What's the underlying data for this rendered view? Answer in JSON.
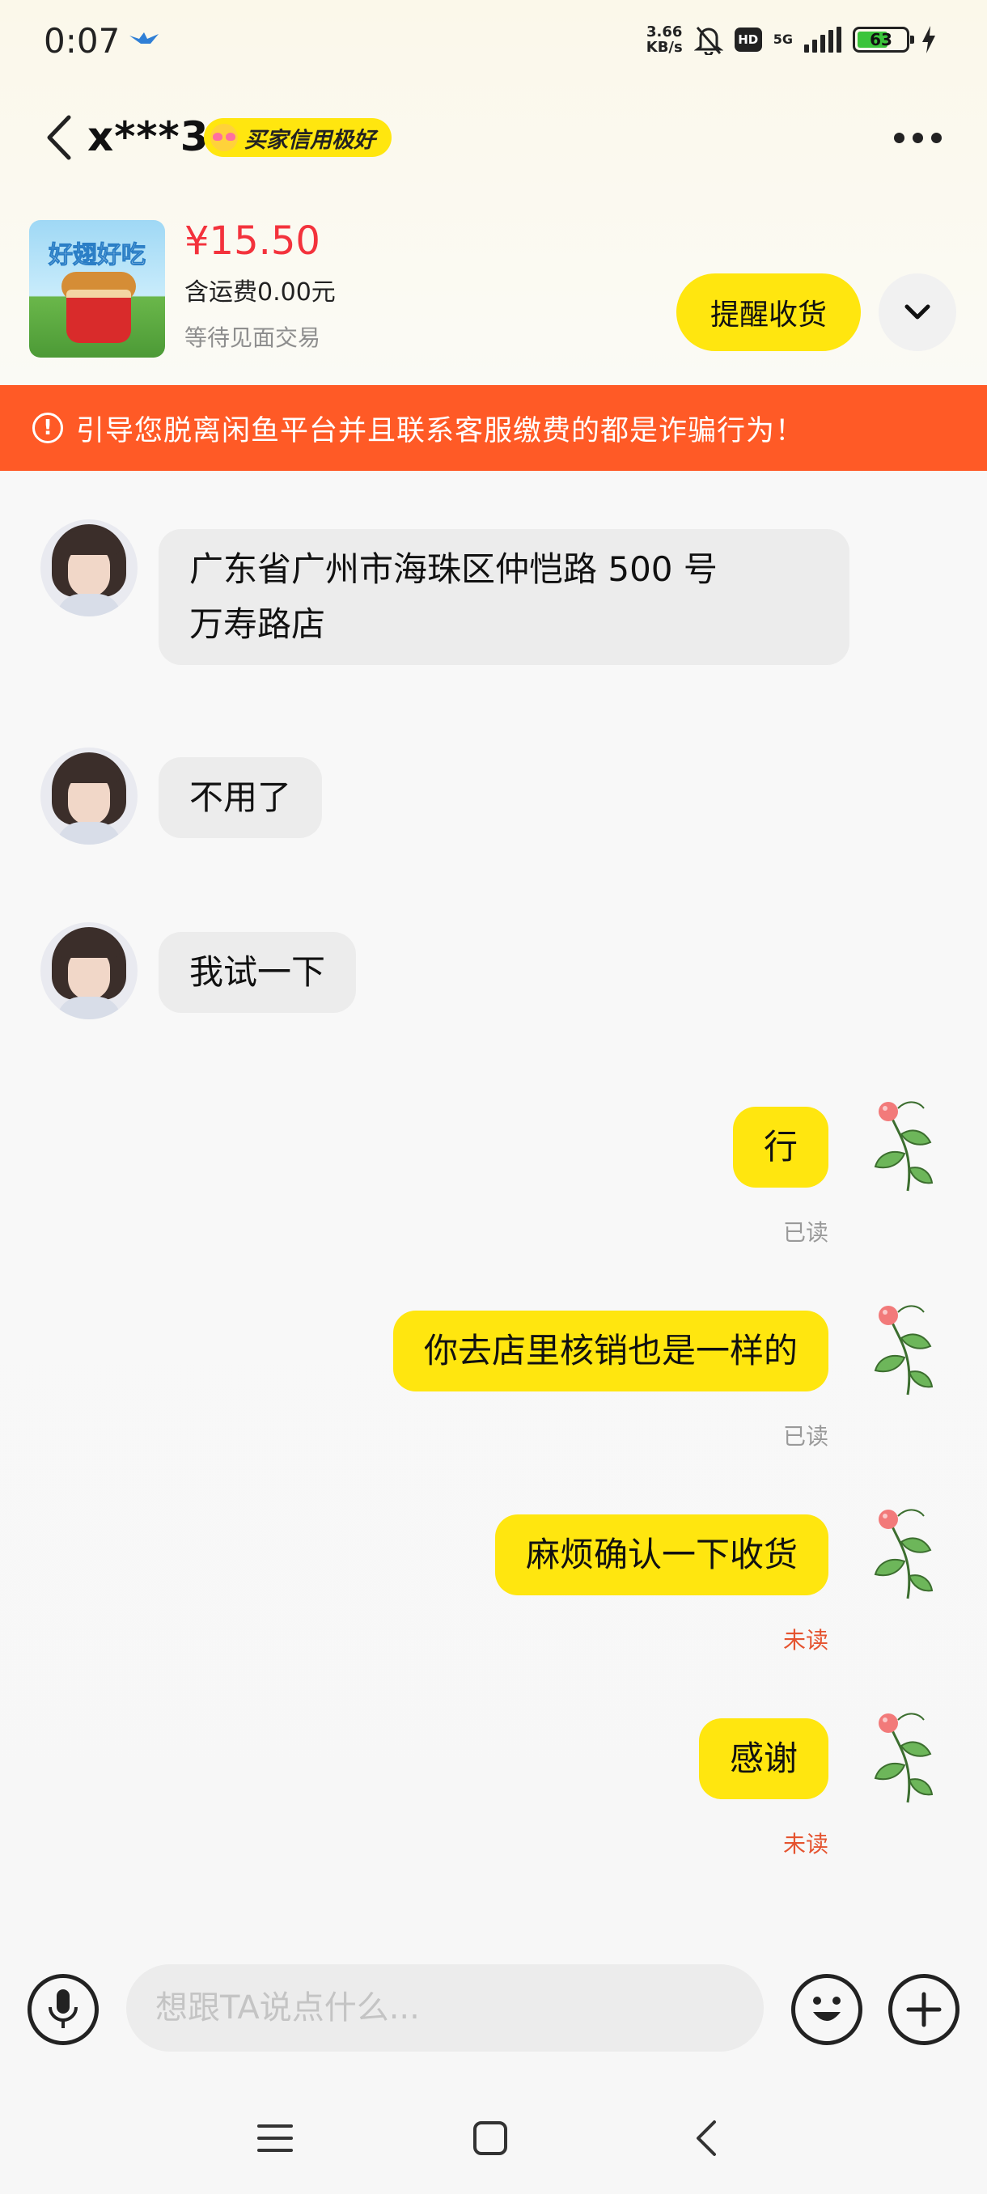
{
  "status_bar": {
    "time": "0:07",
    "net_speed_value": "3.66",
    "net_speed_unit": "KB/s",
    "hd": "HD",
    "network": "5G",
    "battery": "63"
  },
  "header": {
    "username": "x***3",
    "credit_badge": "买家信用极好"
  },
  "product": {
    "thumb_title": "好翅好吃",
    "price": "¥15.50",
    "shipping": "含运费0.00元",
    "status": "等待见面交易",
    "remind_button": "提醒收货"
  },
  "warning": {
    "icon": "!",
    "text": "引导您脱离闲鱼平台并且联系客服缴费的都是诈骗行为！"
  },
  "messages": [
    {
      "from": "other",
      "lines": [
        "广东省广州市海珠区仲恺路 500 号",
        "万寿路店"
      ]
    },
    {
      "from": "other",
      "text": "不用了"
    },
    {
      "from": "other",
      "text": "我试一下"
    },
    {
      "from": "self",
      "text": "行",
      "status": "已读"
    },
    {
      "from": "self",
      "text": "你去店里核销也是一样的",
      "status": "已读"
    },
    {
      "from": "self",
      "text": "麻烦确认一下收货",
      "status": "未读"
    },
    {
      "from": "self",
      "text": "感谢",
      "status": "未读"
    }
  ],
  "input": {
    "placeholder": "想跟TA说点什么..."
  },
  "colors": {
    "accent_yellow": "#ffe60f",
    "warning_orange": "#ff5a26",
    "price_red": "#f3323c",
    "unread_red": "#e5532f"
  },
  "icons": {
    "back": "chevron-left-icon",
    "more": "more-dots-icon",
    "expand": "chevron-down-icon",
    "voice": "microphone-icon",
    "emoji": "smiley-icon",
    "plus": "plus-icon"
  }
}
